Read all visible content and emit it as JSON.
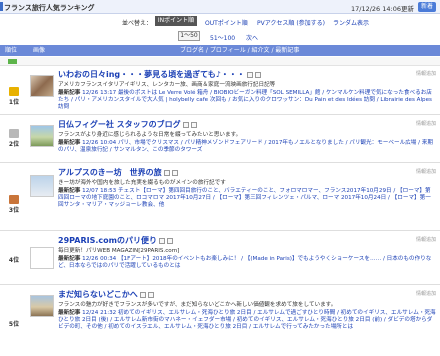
{
  "header": {
    "title": "フランス旅行人気ランキング",
    "date": "17/12/26 14:06更新",
    "badge": "新着"
  },
  "sort": {
    "label": "並べ替え：",
    "selected": "INポイント順",
    "options": [
      "OUTポイント順",
      "PVアクセス順 (参加する)",
      "ランダム表示"
    ]
  },
  "pager": {
    "current": "1〜50",
    "next_range": "51〜100",
    "next": "次へ"
  },
  "table_header": {
    "rank": "順位",
    "image": "画像",
    "blog": "ブログ名 / プロフィール / 紹介文 / 最新記事"
  },
  "entries": [
    {
      "rank": "1位",
      "medal_color": "#e8b100",
      "title": "いわおの日々ing・・・夢見る頃を過ぎても♪・・・",
      "desc": "アメリカフランスイタリアイギリス、レンタカー旅、画商＆家庭一流映画旅行記日記等",
      "latest_label": "最新記事",
      "latest": "12/26 13:17 最後のポストは Le Verre Volé 箱舟 / BIOBIOビーガン料理「SOL SEMILLA」館 / ケンマルケン料理で気になった食べるお店たち / パリ・アメリカンスタイルで大人気 | holybelly cafe 次回も / お気に入りのクロワッサン：Du Pain et des Idées 訪問 / Librairie des Alpes 訪問",
      "status": "情報追加"
    },
    {
      "rank": "2位",
      "medal_color": "#b8b8b8",
      "title": "日仏フィグー社 スタッフのブログ",
      "desc": "フランスがより身近に感じられるような日常を綴ってみたいと思います。",
      "latest_label": "最新記事",
      "latest": "12/26 10:04 パリ、市場でクリスマス / パリ精神メゾンドフェアリード / 2017年もノエルとなりました / パリ観光：モーベール広場 / 来期のパリ、温泉旅行記 / サンマルタン、この季節のタワーズ",
      "status": "情報追加"
    },
    {
      "rank": "3位",
      "medal_color": "#c9753a",
      "title": "アルプスのきー坊　世界の旅",
      "desc": "きー坊が海外や国内を旅した充実を綴るものがメインの旅行記です",
      "latest_label": "最新記事",
      "latest": "12/07 18:53 チェスト【ローマ】第四回目旅行のこと、バラエティーのこと、フォロマロマー、フランス2017年10月29日 / 【ローマ】第四回ローマの地下庭園のこと、ロコマロマ  2017年10月27日 / 【ローマ】第三回フィレンツェ・パルマ、ローマ 2017年10月24日 / 【ローマ】第一回サンタ・マリア・マッジョーレ教会、他",
      "status": "情報追加"
    },
    {
      "rank": "4位",
      "medal_color": "",
      "title": "29PARIS.comのパリ便り",
      "desc": "毎日更新！パリWEB MAGAZIN[29PARIS.com]",
      "latest_label": "最新記事",
      "latest": "12/26 00:34 【1Fアート】2018年のイベントもお楽しみに！ / 【(Made in Paris)】でもようやくショーケースを…… / 日本のもの作りなど、日本ならではのパリで活躍しているものとは",
      "status": "情報追加"
    },
    {
      "rank": "5位",
      "medal_color": "",
      "title": "まだ知らないどこかへ",
      "desc": "フランスの魅力が好きでフランスが多いですが、まだ知らないどこかへ新しい価値観を求めて旅をしています。",
      "latest_label": "最新記事",
      "latest": "12/24 21:32 初めてのイギリス、エルサレム・死海ひとり旅 2日目 / エルサレムで過ごすひとり時間 / 初めてのイギリス、エルサレム・死海ひとり旅 2日目 (後) / エルサレム新市街のマハネー・イェフダー市場 / 初めてのイギリス、エルサレム・死海ひとり旅 2日目 (前) / ダビデの塔からダビデの町、その他 / 初めてのイスラエル、エルサレム・死海ひとり旅 2日目 / エルサレムで行ってみたかった場所とは",
      "status": "情報追加"
    }
  ]
}
